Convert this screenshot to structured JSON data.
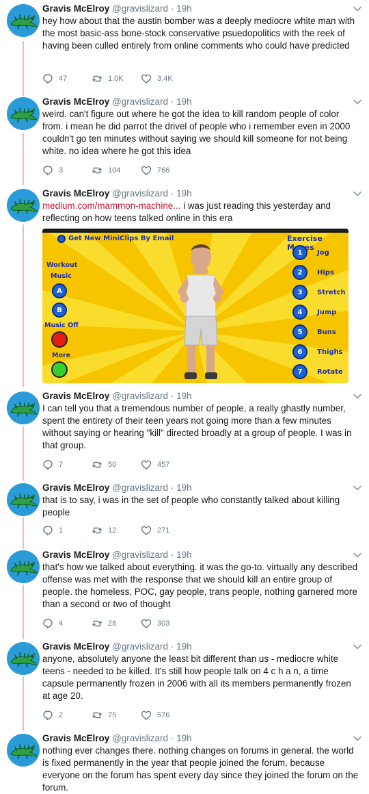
{
  "author": {
    "name": "Gravis McElroy",
    "handle": "@gravislizard",
    "sep": "·",
    "time": "19h"
  },
  "colors": {
    "link": "#c4122f",
    "avatar_bg": "#2b9bd7",
    "thread_line": "#f4b7c1"
  },
  "tweets": [
    {
      "text": "hey how about that the austin bomber was a deeply mediocre white man with the most basic-ass bone-stock conservative psuedopolitics with the reek of having been culled entirely from online comments who could have predicted",
      "replies": "47",
      "retweets": "1.0K",
      "likes": "3.4K"
    },
    {
      "text": "weird. can't figure out where he got the idea to kill random people of color from. i mean he did parrot the drivel of people who i remember even in 2000 couldn't go ten minutes without saying we should kill someone for not being white. no idea where he got this idea",
      "replies": "3",
      "retweets": "104",
      "likes": "766"
    },
    {
      "link": "medium.com/mammon-machine...",
      "text": " i was just reading this yesterday and reflecting on how teens talked online in this era"
    },
    {
      "text": "I can tell you that a tremendous number of people, a really ghastly number, spent the entirety of their teen years not going more than a few minutes without saying or hearing \"kill\" directed broadly at a group of people. I was in that group.",
      "replies": "7",
      "retweets": "50",
      "likes": "457"
    },
    {
      "text": "that is to say, i was in the set of people who constantly talked about killing people",
      "replies": "1",
      "retweets": "12",
      "likes": "271"
    },
    {
      "text": "that's how we talked about everything. it was the go-to. virtually any described offense was met with the response that we should kill an entire group of people. the homeless, POC, gay people, trans people, nothing garnered more than a second or two of thought",
      "replies": "4",
      "retweets": "28",
      "likes": "303"
    },
    {
      "text": "anyone, absolutely anyone the least bit different than us - mediocre white teens - needed to be killed. It's still how people talk on 4 c h a n, a time capsule permanently frozen in 2006 with all its members permanently frozen at age 20.",
      "replies": "2",
      "retweets": "75",
      "likes": "576"
    },
    {
      "text": "nothing ever changes there. nothing changes on forums in general. the world is fixed permanently in the year that people joined the forum, because everyone on the forum has spent every day since they joined the forum on the forum."
    }
  ],
  "media": {
    "email_label": "Get New MiniClips By Email",
    "exercise_title": "Exercise Moves",
    "workout_label_1": "Workout",
    "workout_label_2": "Music",
    "music_off": "Music Off",
    "more": "More",
    "button_a": "A",
    "button_b": "B",
    "moves": [
      {
        "num": "1",
        "label": "Jog"
      },
      {
        "num": "2",
        "label": "Hips"
      },
      {
        "num": "3",
        "label": "Stretch"
      },
      {
        "num": "4",
        "label": "Jump"
      },
      {
        "num": "5",
        "label": "Buns"
      },
      {
        "num": "6",
        "label": "Thighs"
      },
      {
        "num": "7",
        "label": "Rotate"
      }
    ]
  }
}
